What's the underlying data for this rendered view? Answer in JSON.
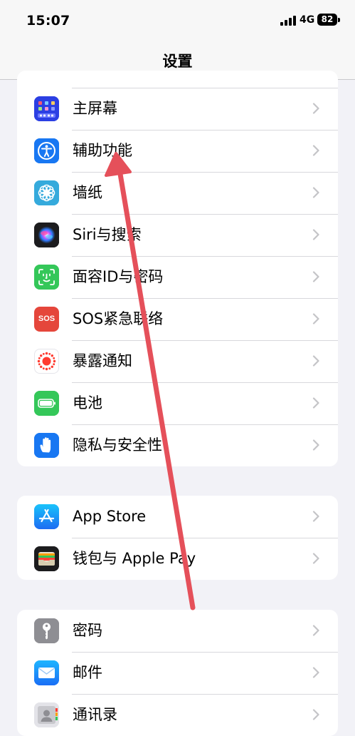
{
  "status_bar": {
    "time": "15:07",
    "network": "4G",
    "battery": "82"
  },
  "nav": {
    "title": "设置"
  },
  "groups": [
    {
      "items": [
        {
          "label": "主屏幕",
          "icon": "home-screen-icon",
          "color": "#2a3ee0"
        },
        {
          "label": "辅助功能",
          "icon": "accessibility-icon",
          "color": "#1877f2"
        },
        {
          "label": "墙纸",
          "icon": "wallpaper-icon",
          "color": "#35aadc"
        },
        {
          "label": "Siri与搜索",
          "icon": "siri-icon",
          "color": "#1c1c1e"
        },
        {
          "label": "面容ID与密码",
          "icon": "face-id-icon",
          "color": "#34c759"
        },
        {
          "label": "SOS紧急联络",
          "icon": "sos-icon",
          "color": "#e5463b",
          "icon_text": "SOS"
        },
        {
          "label": "暴露通知",
          "icon": "exposure-notification-icon",
          "color": "#ffffff"
        },
        {
          "label": "电池",
          "icon": "battery-icon",
          "color": "#34c759"
        },
        {
          "label": "隐私与安全性",
          "icon": "privacy-hand-icon",
          "color": "#1877f2"
        }
      ]
    },
    {
      "items": [
        {
          "label": "App Store",
          "icon": "app-store-icon",
          "color": "#1a8cff"
        },
        {
          "label": "钱包与 Apple Pay",
          "icon": "wallet-icon",
          "color": "#1c1c1e"
        }
      ]
    },
    {
      "items": [
        {
          "label": "密码",
          "icon": "passwords-key-icon",
          "color": "#8e8e93"
        },
        {
          "label": "邮件",
          "icon": "mail-icon",
          "color": "#1a8cff"
        },
        {
          "label": "通讯录",
          "icon": "contacts-icon",
          "color": "#b8b8bd"
        }
      ]
    }
  ],
  "colors": {
    "background": "#f2f2f7",
    "chevron": "#c4c4c7",
    "annotation_arrow": "#e5505a"
  }
}
